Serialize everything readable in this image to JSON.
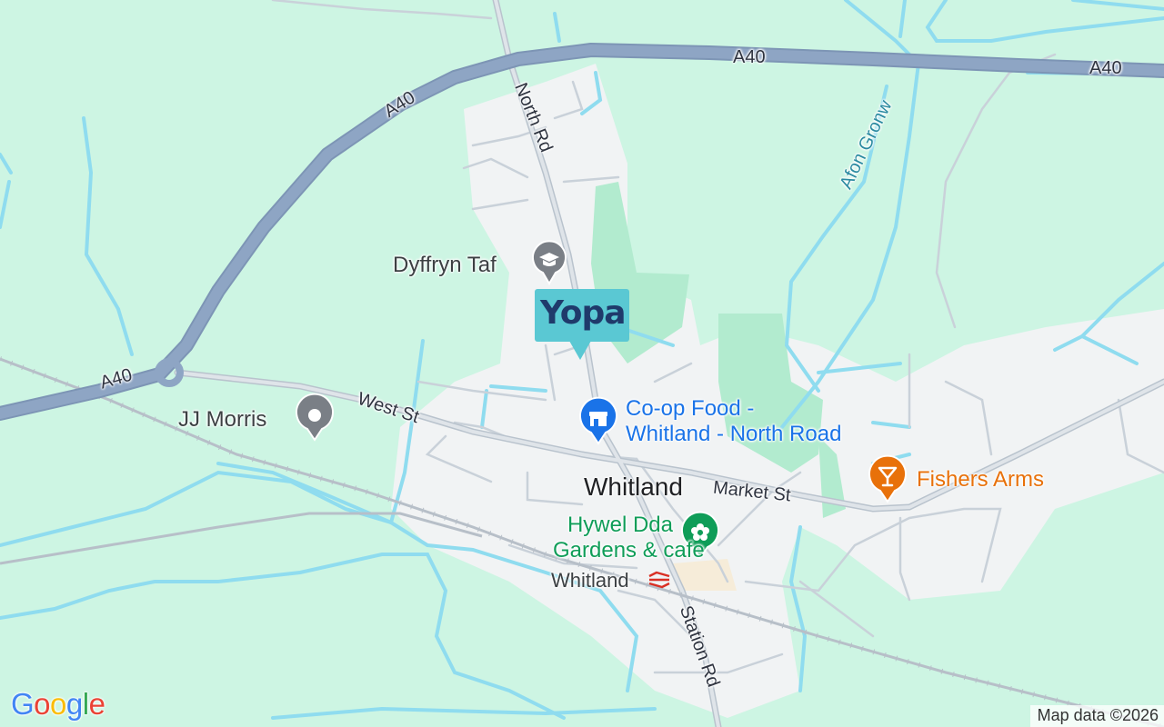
{
  "map": {
    "colors": {
      "land": "#cdf5e3",
      "town": "#f1f3f4",
      "park": "#b2ebcf",
      "water": "#8fdcef",
      "trunk_road": "#8ea5c4",
      "local_road": "#c9d1d9",
      "rail": "#b7bfc8"
    },
    "roads": {
      "a40_labels": [
        "A40",
        "A40",
        "A40"
      ],
      "north_rd": "North Rd",
      "west_st": "West St",
      "market_st": "Market St",
      "station_rd": "Station Rd"
    },
    "water": {
      "afon_gronw": "Afon Gronw"
    },
    "town": {
      "name": "Whitland"
    },
    "places": [
      {
        "name": "Dyffryn Taf",
        "icon": "graduation-cap-icon",
        "color": "#7a7f86"
      },
      {
        "name": "JJ Morris",
        "icon": "place-dot-icon",
        "color": "#7a7f86"
      },
      {
        "name": "Co-op Food - Whitland - North Road",
        "line1": "Co-op Food -",
        "line2": "Whitland - North Road",
        "icon": "shop-icon",
        "color": "#1a73e8"
      },
      {
        "name": "Fishers Arms",
        "icon": "cocktail-icon",
        "color": "#e8710a"
      },
      {
        "name": "Hywel Dda Gardens & cafe",
        "line1": "Hywel Dda",
        "line2": "Gardens & cafe",
        "icon": "flower-icon",
        "color": "#0f9d58"
      },
      {
        "name": "Whitland",
        "icon": "rail-station-icon",
        "color": "#d93025"
      }
    ],
    "marker": {
      "logo_text": "Yopa",
      "color": "#5ac8d3",
      "text_color": "#1f3a6b"
    },
    "google_logo": {
      "letters": [
        "G",
        "o",
        "o",
        "g",
        "l",
        "e"
      ],
      "colors": [
        "#4285f4",
        "#ea4335",
        "#fbbc05",
        "#4285f4",
        "#34a853",
        "#ea4335"
      ]
    },
    "attribution": "Map data ©2026"
  }
}
